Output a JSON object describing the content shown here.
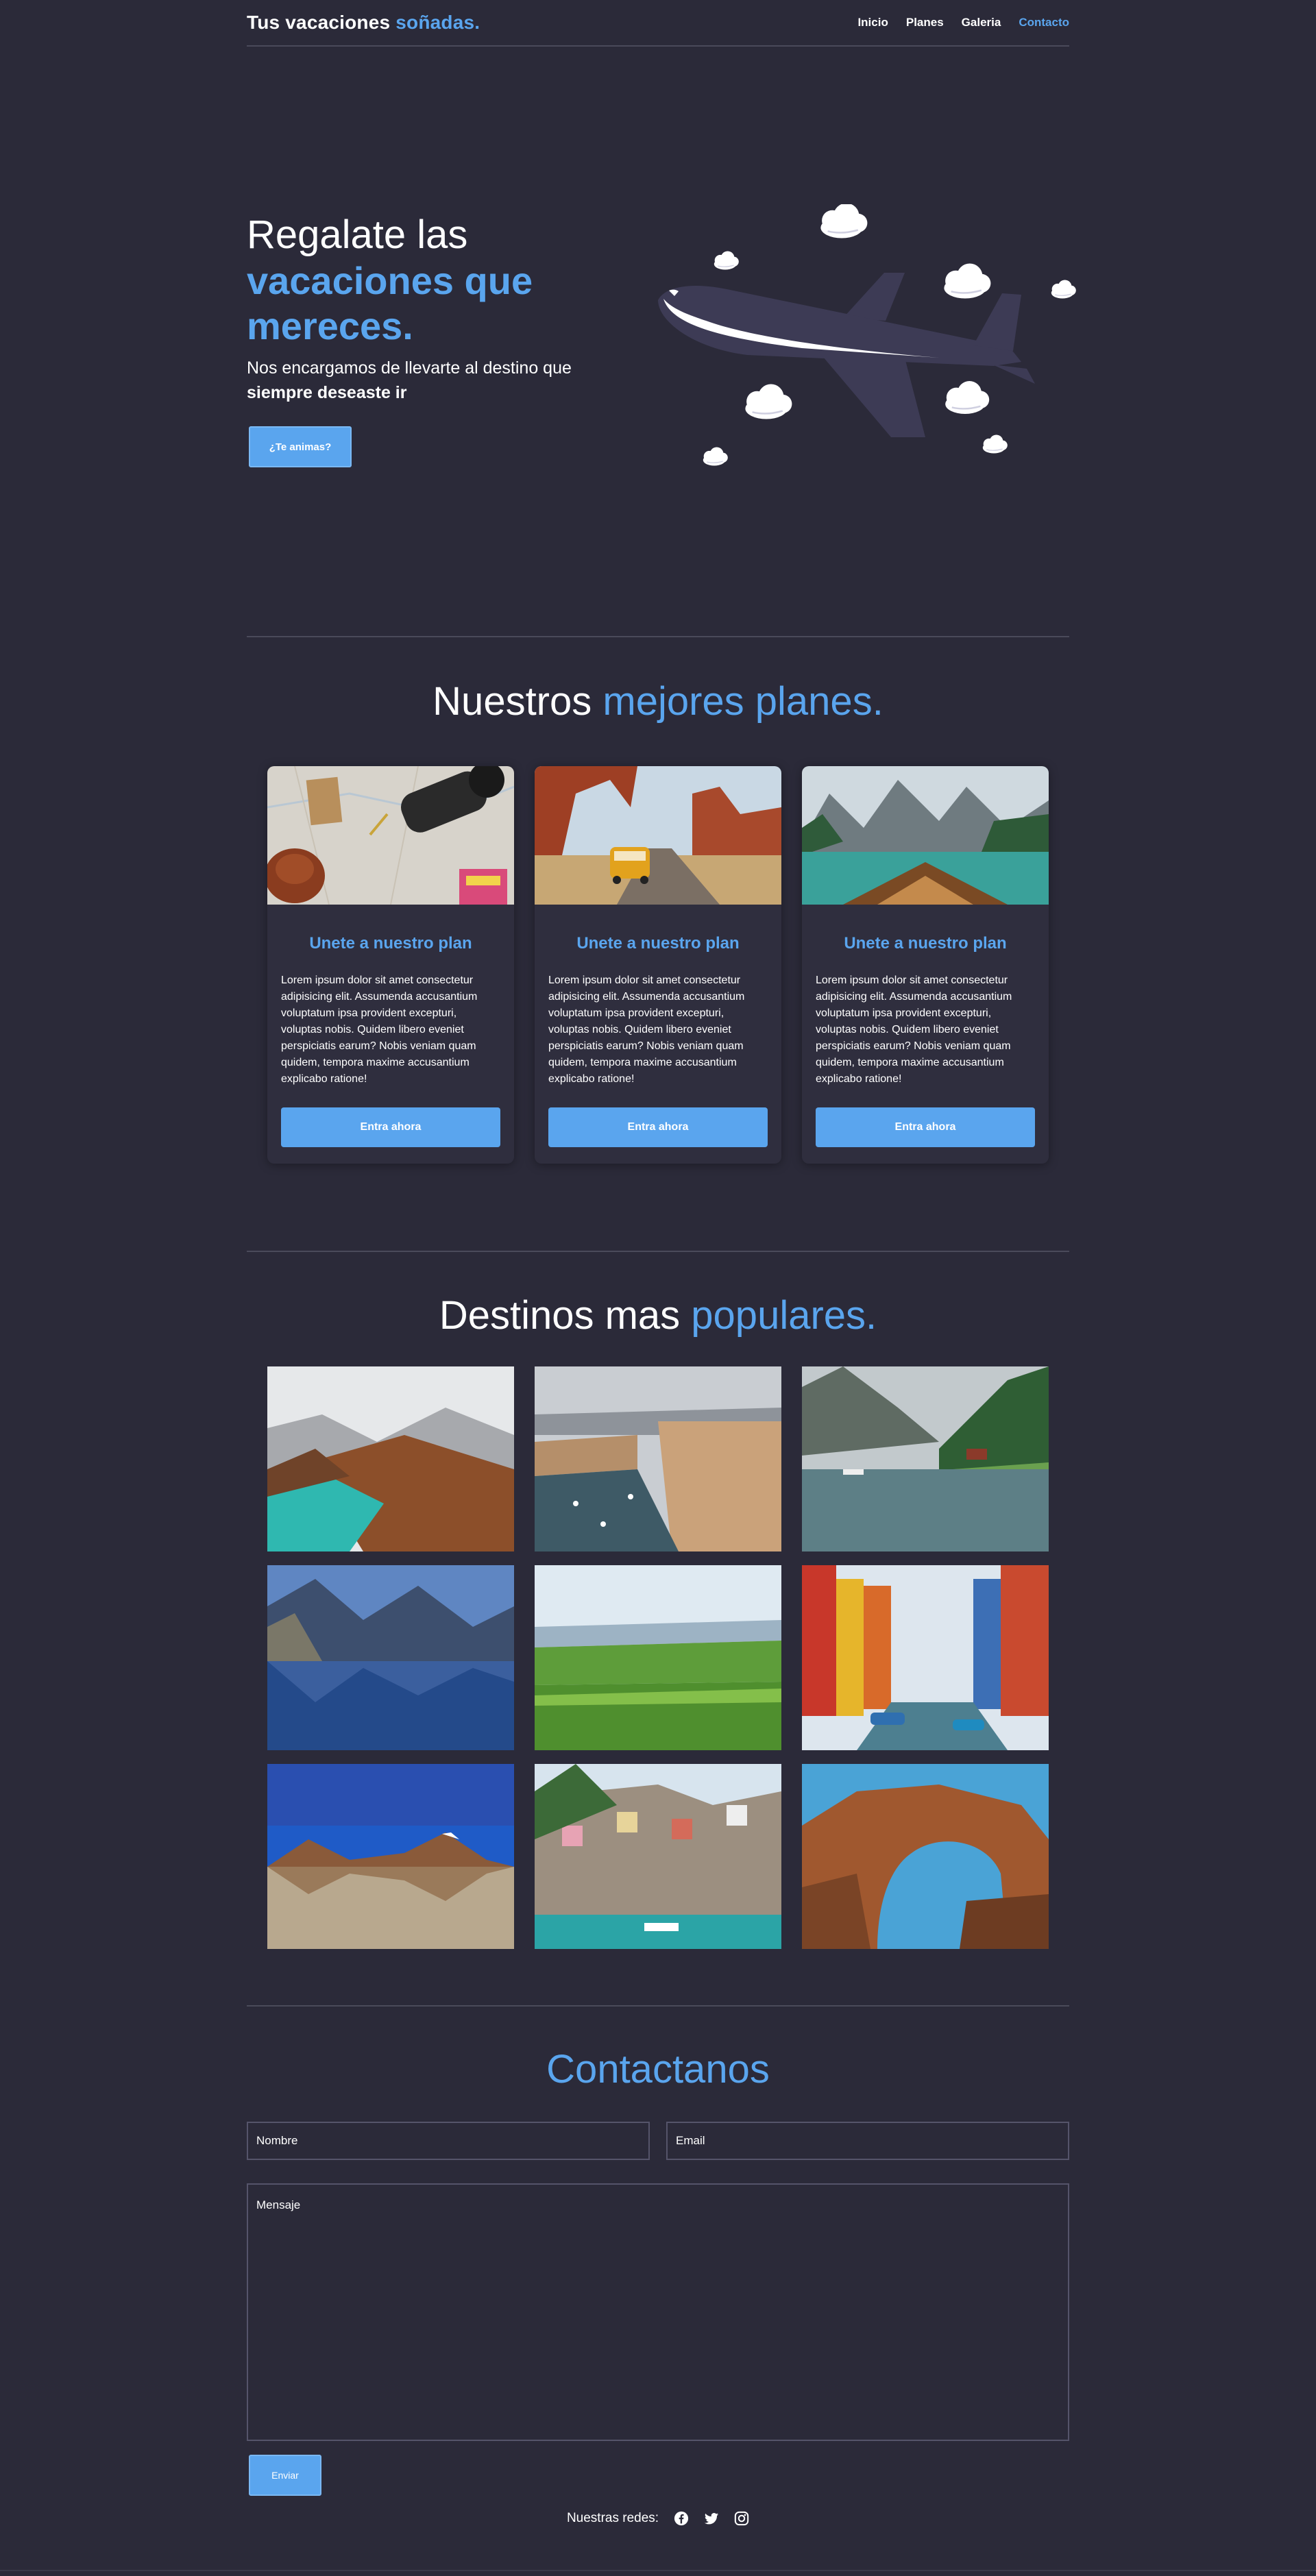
{
  "header": {
    "brand_main": "Tus vacaciones ",
    "brand_accent": "soñadas.",
    "nav": [
      "Inicio",
      "Planes",
      "Galeria",
      "Contacto"
    ]
  },
  "hero": {
    "line1": "Regalate las",
    "line2": "vacaciones que",
    "line3": "mereces.",
    "subtitle_pre": "Nos encargamos de llevarte al destino que ",
    "subtitle_bold": "siempre deseaste ir",
    "cta": "¿Te animas?"
  },
  "plans": {
    "title_main": "Nuestros ",
    "title_accent": "mejores planes.",
    "cards": [
      {
        "title": "Unete a nuestro plan",
        "text": "Lorem ipsum dolor sit amet consectetur adipisicing elit. Assumenda accusantium voluptatum ipsa provident excepturi, voluptas nobis. Quidem libero eveniet perspiciatis earum? Nobis veniam quam quidem, tempora maxime accusantium explicabo ratione!",
        "button": "Entra ahora"
      },
      {
        "title": "Unete a nuestro plan",
        "text": "Lorem ipsum dolor sit amet consectetur adipisicing elit. Assumenda accusantium voluptatum ipsa provident excepturi, voluptas nobis. Quidem libero eveniet perspiciatis earum? Nobis veniam quam quidem, tempora maxime accusantium explicabo ratione!",
        "button": "Entra ahora"
      },
      {
        "title": "Unete a nuestro plan",
        "text": "Lorem ipsum dolor sit amet consectetur adipisicing elit. Assumenda accusantium voluptatum ipsa provident excepturi, voluptas nobis. Quidem libero eveniet perspiciatis earum? Nobis veniam quam quidem, tempora maxime accusantium explicabo ratione!",
        "button": "Entra ahora"
      }
    ]
  },
  "destinations": {
    "title_main": "Destinos mas ",
    "title_accent": "populares."
  },
  "contact": {
    "title": "Contactanos",
    "name_placeholder": "Nombre",
    "email_placeholder": "Email",
    "message_placeholder": "Mensaje",
    "send": "Enviar"
  },
  "footer": {
    "label": "Nuestras redes:",
    "icons": [
      "facebook-icon",
      "twitter-icon",
      "instagram-icon"
    ]
  },
  "colors": {
    "background": "#2b2a39",
    "accent": "#5aa5ee",
    "plane": "#3d3b55"
  }
}
